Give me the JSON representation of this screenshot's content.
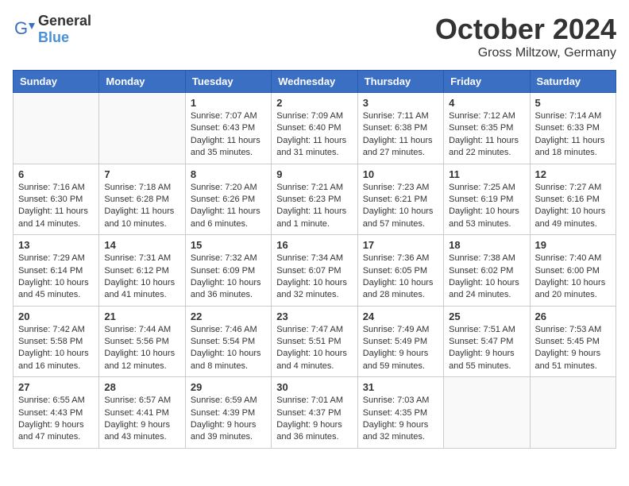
{
  "logo": {
    "general": "General",
    "blue": "Blue"
  },
  "header": {
    "month": "October 2024",
    "location": "Gross Miltzow, Germany"
  },
  "days_of_week": [
    "Sunday",
    "Monday",
    "Tuesday",
    "Wednesday",
    "Thursday",
    "Friday",
    "Saturday"
  ],
  "weeks": [
    [
      {
        "day": "",
        "info": ""
      },
      {
        "day": "",
        "info": ""
      },
      {
        "day": "1",
        "info": "Sunrise: 7:07 AM\nSunset: 6:43 PM\nDaylight: 11 hours and 35 minutes."
      },
      {
        "day": "2",
        "info": "Sunrise: 7:09 AM\nSunset: 6:40 PM\nDaylight: 11 hours and 31 minutes."
      },
      {
        "day": "3",
        "info": "Sunrise: 7:11 AM\nSunset: 6:38 PM\nDaylight: 11 hours and 27 minutes."
      },
      {
        "day": "4",
        "info": "Sunrise: 7:12 AM\nSunset: 6:35 PM\nDaylight: 11 hours and 22 minutes."
      },
      {
        "day": "5",
        "info": "Sunrise: 7:14 AM\nSunset: 6:33 PM\nDaylight: 11 hours and 18 minutes."
      }
    ],
    [
      {
        "day": "6",
        "info": "Sunrise: 7:16 AM\nSunset: 6:30 PM\nDaylight: 11 hours and 14 minutes."
      },
      {
        "day": "7",
        "info": "Sunrise: 7:18 AM\nSunset: 6:28 PM\nDaylight: 11 hours and 10 minutes."
      },
      {
        "day": "8",
        "info": "Sunrise: 7:20 AM\nSunset: 6:26 PM\nDaylight: 11 hours and 6 minutes."
      },
      {
        "day": "9",
        "info": "Sunrise: 7:21 AM\nSunset: 6:23 PM\nDaylight: 11 hours and 1 minute."
      },
      {
        "day": "10",
        "info": "Sunrise: 7:23 AM\nSunset: 6:21 PM\nDaylight: 10 hours and 57 minutes."
      },
      {
        "day": "11",
        "info": "Sunrise: 7:25 AM\nSunset: 6:19 PM\nDaylight: 10 hours and 53 minutes."
      },
      {
        "day": "12",
        "info": "Sunrise: 7:27 AM\nSunset: 6:16 PM\nDaylight: 10 hours and 49 minutes."
      }
    ],
    [
      {
        "day": "13",
        "info": "Sunrise: 7:29 AM\nSunset: 6:14 PM\nDaylight: 10 hours and 45 minutes."
      },
      {
        "day": "14",
        "info": "Sunrise: 7:31 AM\nSunset: 6:12 PM\nDaylight: 10 hours and 41 minutes."
      },
      {
        "day": "15",
        "info": "Sunrise: 7:32 AM\nSunset: 6:09 PM\nDaylight: 10 hours and 36 minutes."
      },
      {
        "day": "16",
        "info": "Sunrise: 7:34 AM\nSunset: 6:07 PM\nDaylight: 10 hours and 32 minutes."
      },
      {
        "day": "17",
        "info": "Sunrise: 7:36 AM\nSunset: 6:05 PM\nDaylight: 10 hours and 28 minutes."
      },
      {
        "day": "18",
        "info": "Sunrise: 7:38 AM\nSunset: 6:02 PM\nDaylight: 10 hours and 24 minutes."
      },
      {
        "day": "19",
        "info": "Sunrise: 7:40 AM\nSunset: 6:00 PM\nDaylight: 10 hours and 20 minutes."
      }
    ],
    [
      {
        "day": "20",
        "info": "Sunrise: 7:42 AM\nSunset: 5:58 PM\nDaylight: 10 hours and 16 minutes."
      },
      {
        "day": "21",
        "info": "Sunrise: 7:44 AM\nSunset: 5:56 PM\nDaylight: 10 hours and 12 minutes."
      },
      {
        "day": "22",
        "info": "Sunrise: 7:46 AM\nSunset: 5:54 PM\nDaylight: 10 hours and 8 minutes."
      },
      {
        "day": "23",
        "info": "Sunrise: 7:47 AM\nSunset: 5:51 PM\nDaylight: 10 hours and 4 minutes."
      },
      {
        "day": "24",
        "info": "Sunrise: 7:49 AM\nSunset: 5:49 PM\nDaylight: 9 hours and 59 minutes."
      },
      {
        "day": "25",
        "info": "Sunrise: 7:51 AM\nSunset: 5:47 PM\nDaylight: 9 hours and 55 minutes."
      },
      {
        "day": "26",
        "info": "Sunrise: 7:53 AM\nSunset: 5:45 PM\nDaylight: 9 hours and 51 minutes."
      }
    ],
    [
      {
        "day": "27",
        "info": "Sunrise: 6:55 AM\nSunset: 4:43 PM\nDaylight: 9 hours and 47 minutes."
      },
      {
        "day": "28",
        "info": "Sunrise: 6:57 AM\nSunset: 4:41 PM\nDaylight: 9 hours and 43 minutes."
      },
      {
        "day": "29",
        "info": "Sunrise: 6:59 AM\nSunset: 4:39 PM\nDaylight: 9 hours and 39 minutes."
      },
      {
        "day": "30",
        "info": "Sunrise: 7:01 AM\nSunset: 4:37 PM\nDaylight: 9 hours and 36 minutes."
      },
      {
        "day": "31",
        "info": "Sunrise: 7:03 AM\nSunset: 4:35 PM\nDaylight: 9 hours and 32 minutes."
      },
      {
        "day": "",
        "info": ""
      },
      {
        "day": "",
        "info": ""
      }
    ]
  ]
}
